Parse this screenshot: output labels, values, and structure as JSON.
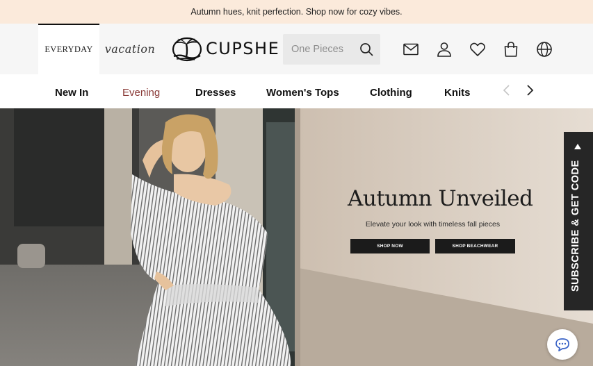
{
  "promo": {
    "text": "Autumn hues, knit perfection. Shop now for cozy vibes."
  },
  "header": {
    "modes": [
      {
        "label": "EVERYDAY",
        "active": true
      },
      {
        "label": "vacation",
        "active": false
      }
    ],
    "logo_text": "CUPSHE",
    "search": {
      "placeholder": "One Pieces"
    },
    "icons": [
      "mail-icon",
      "account-icon",
      "wishlist-heart-icon",
      "shopping-bag-icon",
      "globe-icon"
    ]
  },
  "nav": {
    "items": [
      {
        "label": "New In"
      },
      {
        "label": "Evening"
      },
      {
        "label": "Dresses"
      },
      {
        "label": "Women's Tops"
      },
      {
        "label": "Clothing"
      },
      {
        "label": "Knits"
      }
    ],
    "active_index": 1
  },
  "hero": {
    "title": "Autumn Unveiled",
    "subtitle": "Elevate your look with timeless fall pieces",
    "buttons": [
      {
        "label": "SHOP NOW"
      },
      {
        "label": "SHOP BEACHWEAR"
      }
    ]
  },
  "subscribe": {
    "label": "SUBSCRIBE & GET CODE"
  },
  "chat": {
    "icon": "chat-bubble-icon"
  },
  "colors": {
    "promo_bg": "#fbeadb",
    "active_nav": "#8a3a37",
    "button_bg": "#1b1b1b",
    "subscribe_bg": "#262626"
  }
}
